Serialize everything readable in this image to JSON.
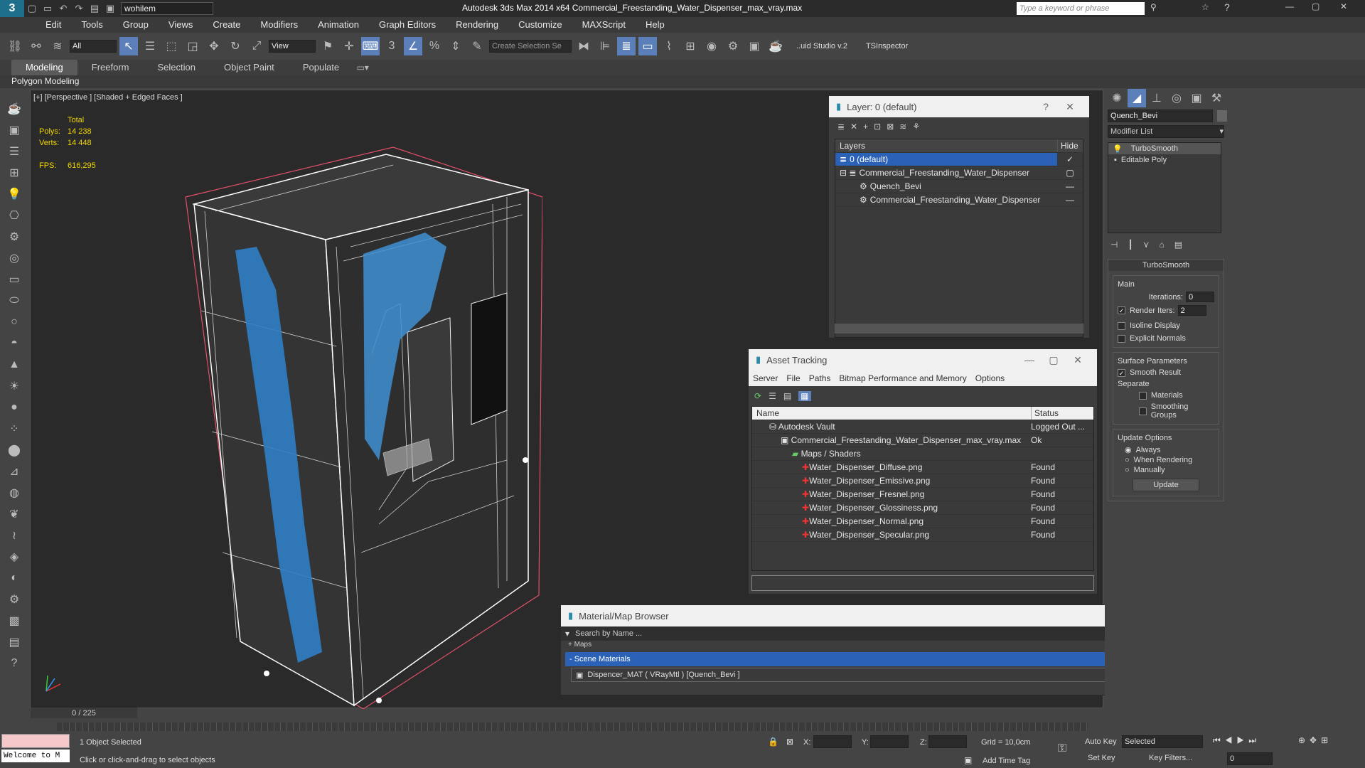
{
  "app": {
    "title": "Autodesk 3ds Max  2014 x64    Commercial_Freestanding_Water_Dispenser_max_vray.max",
    "workspace": "wohilem",
    "search_placeholder": "Type a keyword or phrase"
  },
  "menu": [
    "Edit",
    "Tools",
    "Group",
    "Views",
    "Create",
    "Modifiers",
    "Animation",
    "Graph Editors",
    "Rendering",
    "Customize",
    "MAXScript",
    "Help"
  ],
  "toolbar": {
    "selection_filter": "All",
    "ref_coord": "View",
    "named_sel": "Create Selection Se",
    "studio": "..uid Studio v.2",
    "tsinspector": "TSInspector"
  },
  "ribbon": {
    "tabs": [
      "Modeling",
      "Freeform",
      "Selection",
      "Object Paint",
      "Populate"
    ],
    "active": "Modeling",
    "sub": "Polygon Modeling"
  },
  "viewport": {
    "label": "[+] [Perspective ] [Shaded + Edged Faces ]",
    "stats": {
      "total": "Total",
      "polys_label": "Polys:",
      "polys": "14 238",
      "verts_label": "Verts:",
      "verts": "14 448",
      "fps_label": "FPS:",
      "fps": "616,295"
    }
  },
  "layer_win": {
    "title": "Layer: 0 (default)",
    "col_layers": "Layers",
    "col_hide": "Hide",
    "rows": [
      {
        "name": "0 (default)",
        "indent": 0,
        "selected": true
      },
      {
        "name": "Commercial_Freestanding_Water_Dispenser",
        "indent": 0,
        "selected": false
      },
      {
        "name": "Quench_Bevi",
        "indent": 1,
        "selected": false
      },
      {
        "name": "Commercial_Freestanding_Water_Dispenser",
        "indent": 1,
        "selected": false
      }
    ]
  },
  "asset_win": {
    "title": "Asset Tracking",
    "menu": [
      "Server",
      "File",
      "Paths",
      "Bitmap Performance and Memory",
      "Options"
    ],
    "col_name": "Name",
    "col_status": "Status",
    "rows": [
      {
        "name": "Autodesk Vault",
        "status": "Logged Out ...",
        "indent": 1
      },
      {
        "name": "Commercial_Freestanding_Water_Dispenser_max_vray.max",
        "status": "Ok",
        "indent": 2
      },
      {
        "name": "Maps / Shaders",
        "status": "",
        "indent": 3
      },
      {
        "name": "Water_Dispenser_Diffuse.png",
        "status": "Found",
        "indent": 4
      },
      {
        "name": "Water_Dispenser_Emissive.png",
        "status": "Found",
        "indent": 4
      },
      {
        "name": "Water_Dispenser_Fresnel.png",
        "status": "Found",
        "indent": 4
      },
      {
        "name": "Water_Dispenser_Glossiness.png",
        "status": "Found",
        "indent": 4
      },
      {
        "name": "Water_Dispenser_Normal.png",
        "status": "Found",
        "indent": 4
      },
      {
        "name": "Water_Dispenser_Specular.png",
        "status": "Found",
        "indent": 4
      }
    ]
  },
  "mat_win": {
    "title": "Material/Map Browser",
    "search": "Search by Name ...",
    "maps": "+ Maps",
    "scene": "- Scene Materials",
    "material": "Dispencer_MAT  ( VRayMtl )  [Quench_Bevi ]"
  },
  "cmd": {
    "object_name": "Quench_Bevi",
    "modifier_list": "Modifier List",
    "stack": [
      "TurboSmooth",
      "Editable Poly"
    ],
    "rollout": "TurboSmooth",
    "main": "Main",
    "iterations_label": "Iterations:",
    "iterations": "0",
    "render_iters_label": "Render Iters:",
    "render_iters": "2",
    "isoline": "Isoline Display",
    "explicit": "Explicit Normals",
    "surface": "Surface Parameters",
    "smooth": "Smooth Result",
    "separate": "Separate",
    "materials": "Materials",
    "smoothing_groups": "Smoothing Groups",
    "update_options": "Update Options",
    "always": "Always",
    "when_rendering": "When Rendering",
    "manually": "Manually",
    "update": "Update"
  },
  "status": {
    "frame": "0 / 225",
    "selected": "1 Object Selected",
    "prompt": "Click or click-and-drag to select objects",
    "welcome": "Welcome to M",
    "x": "X:",
    "y": "Y:",
    "z": "Z:",
    "grid": "Grid = 10,0cm",
    "add_time_tag": "Add Time Tag",
    "auto_key": "Auto Key",
    "set_key": "Set Key",
    "key_mode": "Selected",
    "key_filters": "Key Filters...",
    "frame_field": "0"
  }
}
